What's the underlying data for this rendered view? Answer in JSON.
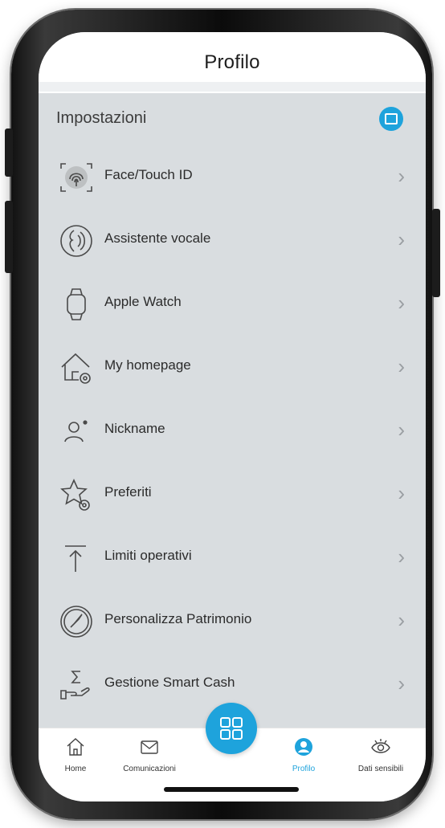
{
  "header": {
    "title": "Profilo"
  },
  "settings": {
    "section_title": "Impostazioni",
    "items": [
      {
        "label": "Face/Touch ID",
        "icon": "fingerprint-icon"
      },
      {
        "label": "Assistente vocale",
        "icon": "voice-assistant-icon"
      },
      {
        "label": "Apple Watch",
        "icon": "watch-icon"
      },
      {
        "label": "My homepage",
        "icon": "home-settings-icon"
      },
      {
        "label": "Nickname",
        "icon": "user-icon"
      },
      {
        "label": "Preferiti",
        "icon": "star-settings-icon"
      },
      {
        "label": "Limiti operativi",
        "icon": "arrow-up-limit-icon"
      },
      {
        "label": "Personalizza Patrimonio",
        "icon": "compass-icon"
      },
      {
        "label": "Gestione Smart Cash",
        "icon": "sigma-hand-icon"
      }
    ]
  },
  "tabbar": {
    "tabs": [
      {
        "label": "Home",
        "icon": "home-icon"
      },
      {
        "label": "Comunicazioni",
        "icon": "mail-icon"
      },
      {
        "label": "Profilo",
        "icon": "profile-icon",
        "active": true
      },
      {
        "label": "Dati sensibili",
        "icon": "eye-icon"
      }
    ],
    "center_button_icon": "grid-icon"
  },
  "colors": {
    "accent": "#1ea3dc",
    "background": "#d9dde0",
    "text": "#2b2b2b"
  }
}
